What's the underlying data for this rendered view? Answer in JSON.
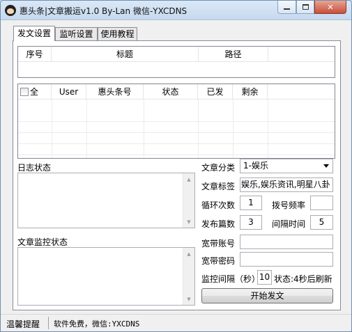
{
  "window": {
    "title": "惠头条|文章搬运v1.0 By-Lan 微信-YXCDNS",
    "controls": {
      "minimize_icon": "minimize-icon",
      "maximize_icon": "maximize-icon",
      "close_glyph": "✕"
    }
  },
  "tabs": [
    {
      "label": "发文设置",
      "active": true
    },
    {
      "label": "监听设置",
      "active": false
    },
    {
      "label": "使用教程",
      "active": false
    }
  ],
  "articles_table": {
    "columns": [
      "序号",
      "标题",
      "路径"
    ],
    "rows": []
  },
  "accounts_table": {
    "select_all_label": "全",
    "columns": [
      "User",
      "惠头条号",
      "状态",
      "已发",
      "剩余"
    ],
    "rows": []
  },
  "log": {
    "label": "日志状态",
    "content": ""
  },
  "monitor_log": {
    "label": "文章监控状态",
    "content": ""
  },
  "form": {
    "category_label": "文章分类",
    "category_value": "1-娱乐",
    "tags_label": "文章标签",
    "tags_value": "娱乐,娱乐资讯,明星八卦",
    "loop_label": "循环次数",
    "loop_value": "1",
    "dial_label": "拨号频率",
    "dial_value": "",
    "publish_label": "发布篇数",
    "publish_value": "3",
    "interval_label": "间隔时间",
    "interval_value": "5",
    "broadband_account_label": "宽带账号",
    "broadband_account_value": "",
    "broadband_password_label": "宽带密码",
    "broadband_password_value": "",
    "monitor_interval_label": "监控间隔（秒）",
    "monitor_interval_value": "10",
    "status_text": "状态:4秒后刷新",
    "start_button": "开始发文"
  },
  "statusbar": {
    "tip_label": "温馨提醒",
    "message": "软件免费，微信:YXCDNS"
  }
}
